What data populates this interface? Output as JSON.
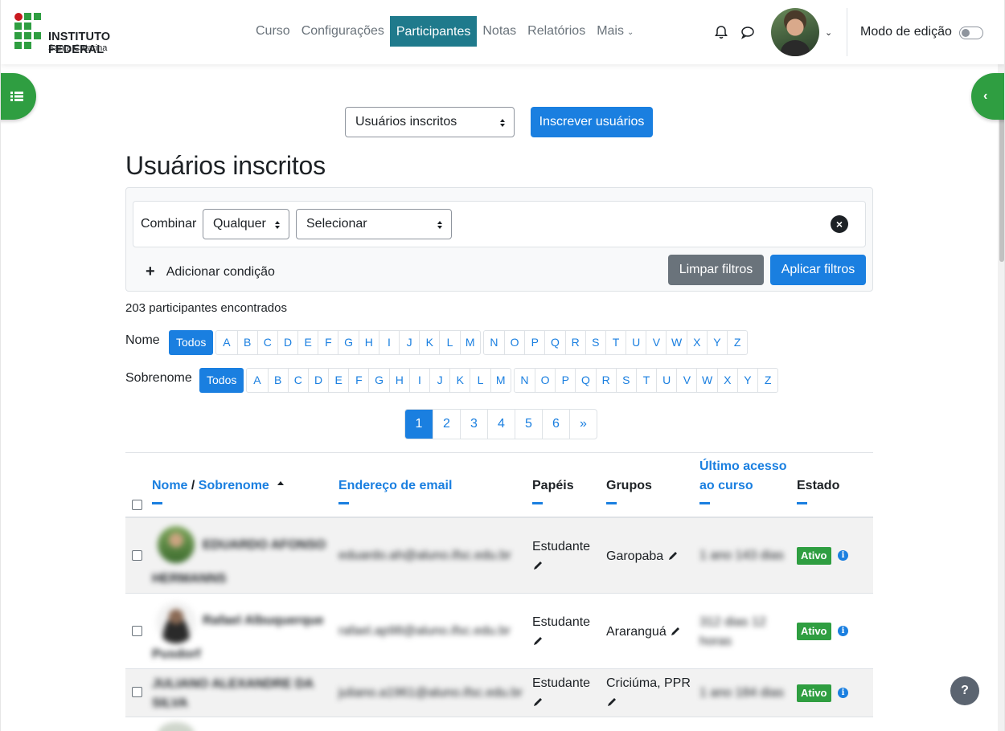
{
  "header": {
    "logo_title": "INSTITUTO FEDERAL",
    "logo_subtitle": "Santa Catarina",
    "nav": [
      "Curso",
      "Configurações",
      "Participantes",
      "Notas",
      "Relatórios"
    ],
    "nav_more": "Mais",
    "nav_active": "Participantes",
    "edit_mode_label": "Modo de edição",
    "edit_mode_on": false
  },
  "toolbar": {
    "view_select": "Usuários inscritos",
    "enrol_button": "Inscrever usuários"
  },
  "page_title": "Usuários inscritos",
  "filter": {
    "combine_label": "Combinar",
    "match_select": "Qualquer",
    "type_select": "Selecionar",
    "add_condition": "Adicionar condição",
    "clear_button": "Limpar filtros",
    "apply_button": "Aplicar filtros"
  },
  "count_text": "203 participantes encontrados",
  "initials": {
    "first_label": "Nome",
    "last_label": "Sobrenome",
    "all": "Todos",
    "group1": [
      "A",
      "B",
      "C",
      "D",
      "E",
      "F",
      "G",
      "H",
      "I",
      "J",
      "K",
      "L",
      "M"
    ],
    "group2": [
      "N",
      "O",
      "P",
      "Q",
      "R",
      "S",
      "T",
      "U",
      "V",
      "W",
      "X",
      "Y",
      "Z"
    ]
  },
  "pagination": [
    "1",
    "2",
    "3",
    "4",
    "5",
    "6",
    "»"
  ],
  "pagination_current": "1",
  "table": {
    "col_name_a": "Nome",
    "col_name_sep": " / ",
    "col_name_b": "Sobrenome",
    "col_email": "Endereço de email",
    "col_roles": "Papéis",
    "col_groups": "Grupos",
    "col_access_1": "Último acesso",
    "col_access_2": "ao curso",
    "col_status": "Estado",
    "rows": [
      {
        "name_1": "EDUARDO AFONSO",
        "name_2": "HERMANNS",
        "email": "eduardo.ah@aluno.ifsc.edu.br",
        "role": "Estudante",
        "group": "Garopaba",
        "group_2": "",
        "access_1": "1 ano 143 dias",
        "access_2": "",
        "status": "Ativo"
      },
      {
        "name_1": "Rafael Albuquerque",
        "name_2": "Pusdorf",
        "email": "rafael.ap98@aluno.ifsc.edu.br",
        "role": "Estudante",
        "group": "Araranguá",
        "group_2": "",
        "access_1": "312 dias 12",
        "access_2": "horas",
        "status": "Ativo"
      },
      {
        "name_1": "JULIANO ALEXANDRE DA",
        "name_2": "SILVA",
        "email": "juliano.a1961@aluno.ifsc.edu.br",
        "role": "Estudante",
        "group": "Criciúma, PPR",
        "group_2": "",
        "access_1": "1 ano 184 dias",
        "access_2": "",
        "status": "Ativo"
      }
    ]
  },
  "help_label": "?"
}
